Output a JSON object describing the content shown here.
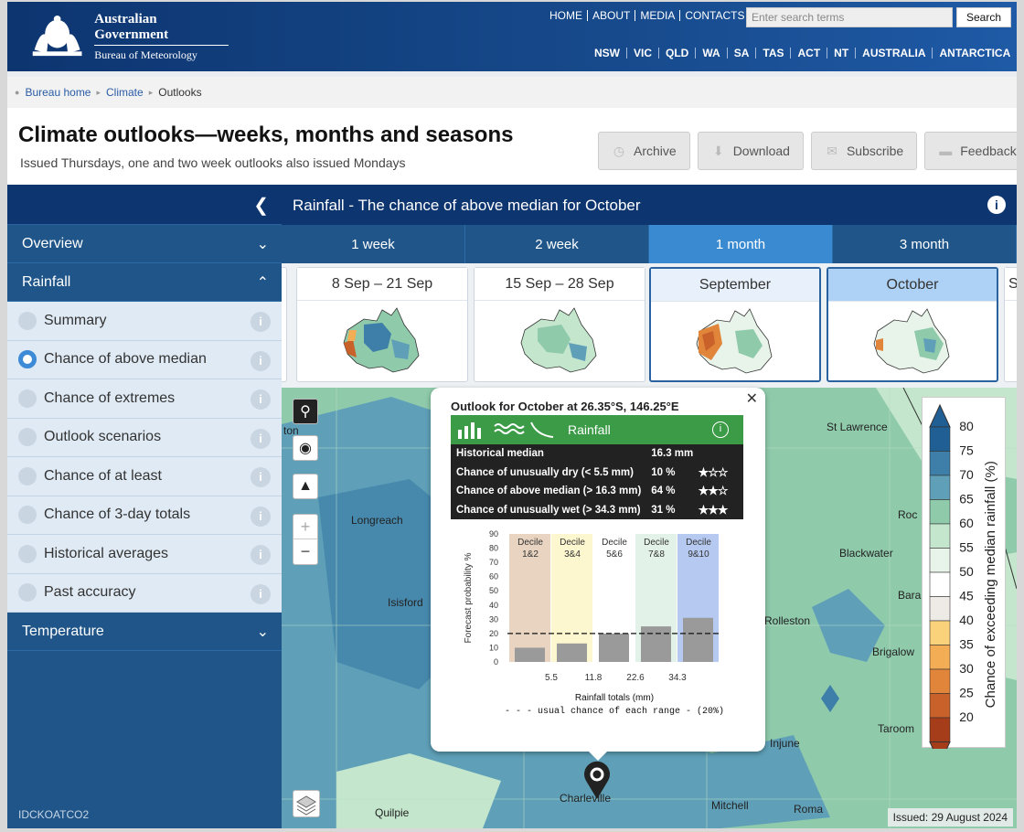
{
  "header": {
    "logo_line1": "Australian Government",
    "logo_line2": "Bureau of Meteorology",
    "top_links": [
      "HOME",
      "ABOUT",
      "MEDIA",
      "CONTACTS"
    ],
    "search_placeholder": "Enter search terms",
    "search_button": "Search",
    "states": [
      "NSW",
      "VIC",
      "QLD",
      "WA",
      "SA",
      "TAS",
      "ACT",
      "NT",
      "AUSTRALIA",
      "ANTARCTICA"
    ]
  },
  "breadcrumb": [
    "Bureau home",
    "Climate",
    "Outlooks"
  ],
  "page": {
    "title": "Climate outlooks—weeks, months and seasons",
    "subtitle": "Issued Thursdays, one and two week outlooks also issued Mondays",
    "actions": [
      "Archive",
      "Download",
      "Subscribe",
      "Feedback"
    ]
  },
  "sidebar": {
    "sections": {
      "overview": "Overview",
      "rainfall": "Rainfall",
      "temperature": "Temperature"
    },
    "items": [
      {
        "label": "Summary",
        "selected": false
      },
      {
        "label": "Chance of above median",
        "selected": true
      },
      {
        "label": "Chance of extremes",
        "selected": false
      },
      {
        "label": "Outlook scenarios",
        "selected": false
      },
      {
        "label": "Chance of at least",
        "selected": false
      },
      {
        "label": "Chance of 3-day totals",
        "selected": false
      },
      {
        "label": "Historical averages",
        "selected": false
      },
      {
        "label": "Past accuracy",
        "selected": false
      }
    ],
    "code": "IDCKOATCO2"
  },
  "main": {
    "title": "Rainfall - The chance of above median for October",
    "tabs": [
      {
        "label": "1 week",
        "active": false
      },
      {
        "label": "2 week",
        "active": false
      },
      {
        "label": "1 month",
        "active": true
      },
      {
        "label": "3 month",
        "active": false
      }
    ],
    "thumbnails": [
      "8 Sep – 21 Sep",
      "15 Sep – 28 Sep",
      "September",
      "October",
      "S"
    ]
  },
  "map": {
    "towns": [
      "ton",
      "St Lawrence",
      "Longreach",
      "Rockhampton",
      "Blackwater",
      "Isisford",
      "Baralaba",
      "Rolleston",
      "Brigalow",
      "Taroom",
      "Injune",
      "Charleville",
      "Mitchell",
      "Roma",
      "Quilpie"
    ],
    "issued": "Issued: 29 August 2024"
  },
  "popup": {
    "title": "Outlook for October at 26.35°S, 146.25°E",
    "bar_label": "Rainfall",
    "rows": [
      {
        "label": "Historical median",
        "value": "16.3 mm",
        "stars": ""
      },
      {
        "label": "Chance of unusually dry (< 5.5 mm)",
        "value": "10 %",
        "stars": "★☆☆"
      },
      {
        "label": "Chance of above median (> 16.3 mm)",
        "value": "64 %",
        "stars": "★★☆"
      },
      {
        "label": "Chance of unusually wet (> 34.3 mm)",
        "value": "31 %",
        "stars": "★★★"
      }
    ]
  },
  "chart_data": {
    "type": "bar",
    "categories": [
      "Decile 1&2",
      "Decile 3&4",
      "Decile 5&6",
      "Decile 7&8",
      "Decile 9&10"
    ],
    "values": [
      10,
      13,
      20,
      25,
      31
    ],
    "ylabel": "Forecast probability %",
    "xlabel": "Rainfall totals (mm)",
    "ylim": [
      0,
      90
    ],
    "yticks": [
      0,
      10,
      20,
      30,
      40,
      50,
      60,
      70,
      80,
      90
    ],
    "x_boundaries": [
      "5.5",
      "11.8",
      "22.6",
      "34.3"
    ],
    "reference_line": 20,
    "note": "- - - usual chance of each range - (20%)",
    "band_colors": [
      "#e8d4c0",
      "#fdf7cf",
      "#ffffff",
      "#e2f2e8",
      "#b6c9f0"
    ],
    "bar_color": "#9a9a9a"
  },
  "legend": {
    "title": "Chance of exceeding median rainfall (%)",
    "levels": [
      {
        "label": "80",
        "color": "#1f5f94"
      },
      {
        "label": "75",
        "color": "#3d7fa8"
      },
      {
        "label": "70",
        "color": "#5fa0b8"
      },
      {
        "label": "65",
        "color": "#8fcaab"
      },
      {
        "label": "60",
        "color": "#c3e6cc"
      },
      {
        "label": "55",
        "color": "#e8f4ea"
      },
      {
        "label": "50",
        "color": "#ffffff"
      },
      {
        "label": "45",
        "color": "#eeeae6"
      },
      {
        "label": "40",
        "color": "#fbd27c"
      },
      {
        "label": "35",
        "color": "#f3ad54"
      },
      {
        "label": "30",
        "color": "#e0853a"
      },
      {
        "label": "25",
        "color": "#c9612a"
      },
      {
        "label": "20",
        "color": "#a53c1a"
      }
    ]
  }
}
